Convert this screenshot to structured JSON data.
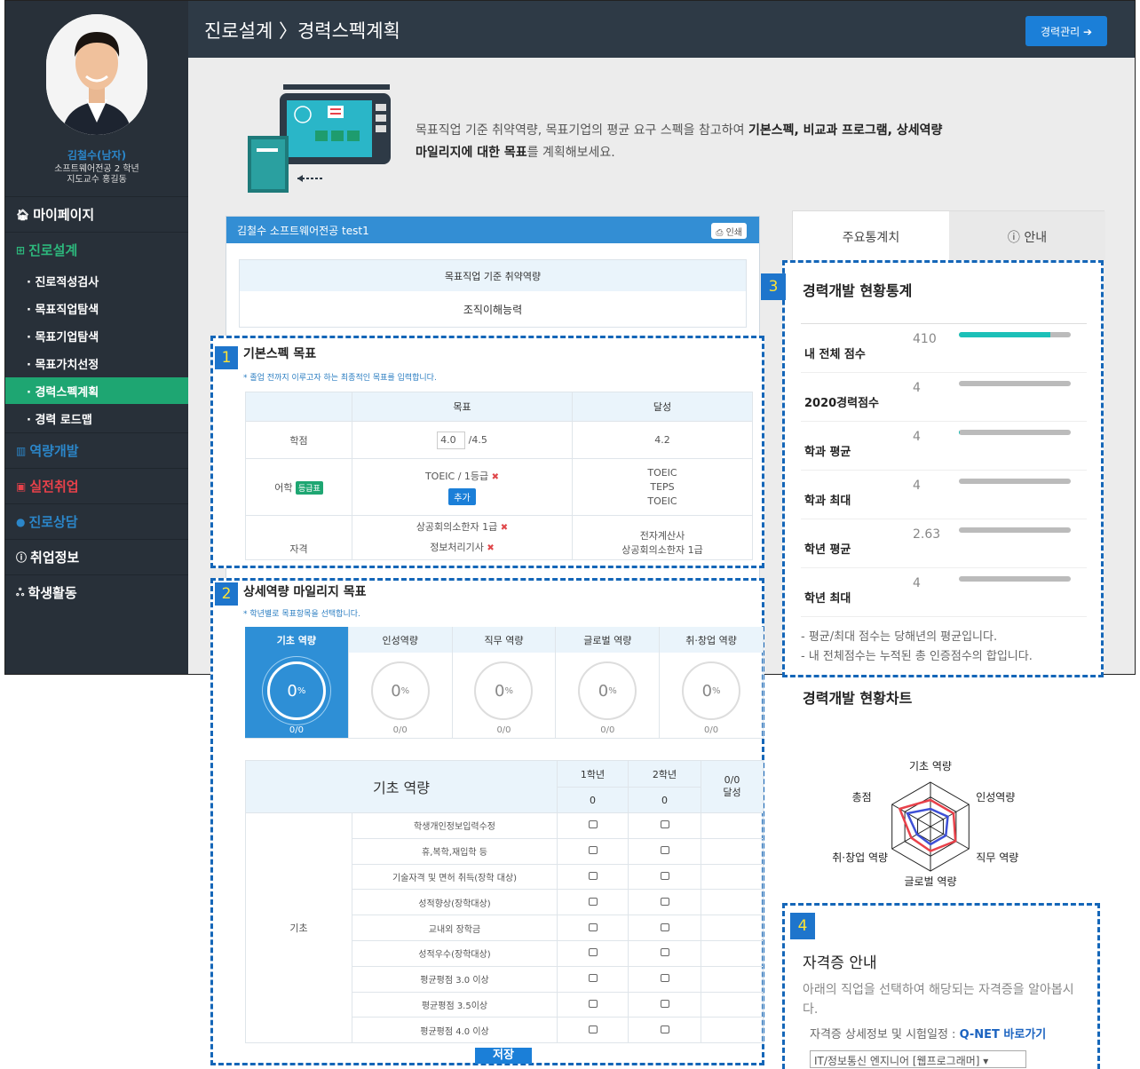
{
  "profile": {
    "name": "김철수(남자)",
    "dept": "소프트웨어전공 2 학년",
    "professor": "지도교수 홍길동"
  },
  "menu": {
    "mypage": "마이페이지",
    "career_design": "진로설계",
    "subs": [
      "· 진로적성검사",
      "· 목표직업탐색",
      "· 목표기업탐색",
      "· 목표가치선정",
      "· 경력스펙계획",
      "· 경력 로드맵"
    ],
    "capability": "역량개발",
    "job": "실전취업",
    "counsel": "진로상담",
    "jobinfo": "취업정보",
    "activity": "학생활동"
  },
  "header": {
    "breadcrumb": "진로설계 〉경력스펙계획",
    "career_btn": "경력관리 ➔"
  },
  "hero": {
    "text1": "목표직업 기준 취약역량, 목표기업의 평균 요구 스펙을 참고하여 ",
    "bold1": "기본스펙, 비교과 프로그램, 상세역량",
    "bold2": "마일리지에 대한 목표",
    "text2": "를 계획해보세요."
  },
  "panel": {
    "title": "김철수 소프트웨어전공 test1",
    "print": "인쇄",
    "weak_head": "목표직업 기준 취약역량",
    "weak_value": "조직이해능력"
  },
  "tabs": {
    "stats": "주요통계치",
    "info": "안내"
  },
  "sec1": {
    "num": "1",
    "title": "기본스펙 목표",
    "note": "* 졸업 전까지 이루고자 하는 최종적인 목표를 입력합니다.",
    "col_goal": "목표",
    "col_achieve": "달성",
    "gpa_label": "학점",
    "gpa_value": "4.0",
    "gpa_max": "/4.5",
    "gpa_achieve": "4.2",
    "lang_label": "어학",
    "lang_tag": "등급표",
    "lang_goal": "TOEIC / 1등급",
    "add_btn": "추가",
    "lang_achieve": [
      "TOEIC",
      "TEPS",
      "TOEIC"
    ],
    "cert_label": "자격",
    "cert_goal": [
      "상공회의소한자 1급",
      "정보처리기사"
    ],
    "cert_achieve": [
      "전자계산사",
      "상공회의소한자 1급"
    ]
  },
  "sec2": {
    "num": "2",
    "title": "상세역량 마일리지 목표",
    "note": "* 학년별로 목표항목을 선택합니다.",
    "competencies": [
      {
        "name": "기초 역량",
        "pct": "0",
        "frac": "0/0"
      },
      {
        "name": "인성역량",
        "pct": "0",
        "frac": "0/0"
      },
      {
        "name": "직무 역량",
        "pct": "0",
        "frac": "0/0"
      },
      {
        "name": "글로벌 역량",
        "pct": "0",
        "frac": "0/0"
      },
      {
        "name": "취·창업 역량",
        "pct": "0",
        "frac": "0/0"
      }
    ],
    "pct_unit": "%",
    "table_title": "기초 역량",
    "grade1": "1학년",
    "grade2": "2학년",
    "g1_count": "0",
    "g2_count": "0",
    "achieve_frac": "0/0",
    "achieve_label": "달성",
    "category": "기초",
    "items": [
      "학생개인정보입력수정",
      "휴,복학,재입학 등",
      "기술자격 및 면허 취득(장학 대상)",
      "성적향상(장학대상)",
      "교내외 장학금",
      "성적우수(장학대상)",
      "평균평점 3.0 이상",
      "평균평점 3.5이상",
      "평균평점 4.0 이상"
    ],
    "save": "저장"
  },
  "sec3": {
    "num": "3",
    "title": "경력개발 현황통계",
    "rows": [
      {
        "label": "내 전체 점수",
        "value": "410",
        "fill": 0.82
      },
      {
        "label": "2020경력점수",
        "value": "4",
        "fill": 0.0
      },
      {
        "label": "학과 평균",
        "value": "4",
        "fill": 0.01
      },
      {
        "label": "학과 최대",
        "value": "4",
        "fill": 0.0
      },
      {
        "label": "학년 평균",
        "value": "2.63",
        "fill": 0.0
      },
      {
        "label": "학년 최대",
        "value": "4",
        "fill": 0.0
      }
    ],
    "note1": "- 평균/최대 점수는 당해년의 평균입니다.",
    "note2": "- 내 전체점수는 누적된 총 인증점수의 합입니다."
  },
  "radar": {
    "title": "경력개발 현황차트",
    "labels": [
      "기초 역량",
      "인성역량",
      "직무 역량",
      "글로벌 역량",
      "취·창업 역량",
      "총점"
    ],
    "colors": {
      "red": "#e8414a",
      "blue": "#3d4fd6"
    }
  },
  "sec4": {
    "num": "4",
    "title": "자격증 안내",
    "desc": "아래의 직업을 선택하여 해당되는 자격증을 알아봅시다.",
    "link_prefix": "자격증 상세정보 및 시험일정 : ",
    "link": "Q-NET 바로가기",
    "select": "IT/정보통신 엔지니어 [웹프로그래머]"
  }
}
